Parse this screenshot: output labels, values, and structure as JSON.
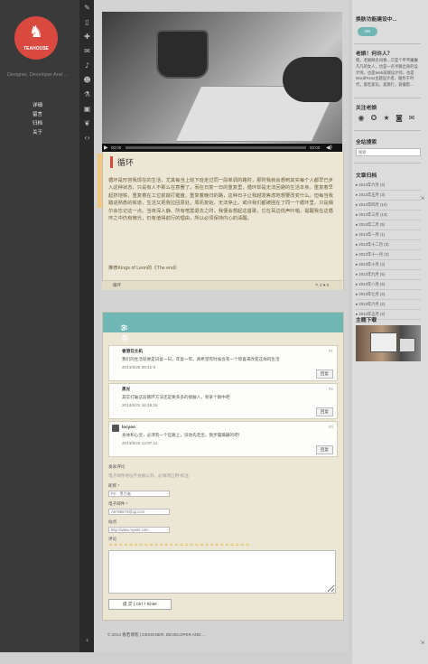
{
  "brand": {
    "logo_text": "TEAHOUSE",
    "tagline": "Designer, Developer And ..."
  },
  "nav": [
    {
      "label": "详细"
    },
    {
      "label": "留言"
    },
    {
      "label": "归档"
    },
    {
      "label": "关于"
    }
  ],
  "icons": [
    "comment-icon",
    "tablet-icon",
    "gamepad-icon",
    "envelope-icon",
    "camera-icon",
    "music-icon",
    "flask-icon",
    "film-icon",
    "image-icon",
    "code-icon"
  ],
  "player": {
    "current": "00:00",
    "total": "00:00"
  },
  "post": {
    "title": "循环",
    "body": "循环是形容我现在的生活，尤其每当上班下班走过同一段单调的路时，那时我就会想到其实每个人都早已步入这种状态，只是有人不那么在意罢了。而在日复一日的重复里，循环却是无法回避的生活本身。重复着早起挤地铁，重复着在工位前敲打键盘，重复着晚归的路，这种日子让我越发焦虑地想要改变什么。但每当我踏进熟悉的街道，生活又把我拉回原处，周而复始，无法停止。或许我们都被困在了同一个循环里，只是偶尔会忘记这一点。当夜深人静、所有喧嚣退去之时，我便会想起这首歌，它在耳边低声吟唱，提醒我在这循环之中仍有微光，仍有值得前行的理由，所以必须保持内心的清醒。",
    "signature": "推荐Kings of Leon的《The end》",
    "category": "循环",
    "comment_count": "3",
    "like_count": "0"
  },
  "comments_section": {
    "header": "3 条留言",
    "comments": [
      {
        "name": "香港云主机",
        "num": "#1",
        "text": "我们的生活就要是日复一日，年复一年。真希望有时候会有一个惊喜来改变这样的生活",
        "date": "2014/6/25 09:41:9",
        "reply": "回复"
      },
      {
        "name": "黑光",
        "num": "#2",
        "text": "其实打破这段循环方法还是要多多的接触人，到某个群中吧",
        "date": "2014/6/22 16:16:16",
        "reply": "回复"
      },
      {
        "name": "locyoo",
        "num": "#3",
        "text": "身体和心灵，必须有一个在路上，没动先走出，我步履蹒跚的吧！",
        "date": "2014/6/22 13:07:11",
        "reply": "回复"
      }
    ],
    "form": {
      "title": "发表评论",
      "note": "电子邮件地址不会被公开。必填项已用*标注",
      "name_label": "昵称 *",
      "name_placeholder": "PC - 黑引者",
      "email_label": "电子邮件 *",
      "email_placeholder": "A6786570@qq.com",
      "site_label": "站点",
      "site_placeholder": "http://www.mysite.com",
      "comment_label": "评论",
      "smileys": "☺☺☺☺☺☺☺☺☺☺☺☺☺☺☺☺☺☺☺☺☺☺☺☺☺☺☺☺",
      "submit": "提 交 ( Ctrl + Enter"
    }
  },
  "footer": {
    "text": "© 2014 春若博客 | DESIGNER, DEVELOPER AND ..."
  },
  "sidebar": {
    "switch_title": "换肤功能建设中...",
    "switch_label": "ON",
    "about_title": "老娘！何许人？",
    "about_text": "嗯，老娘网名叫春…只是个平平庸庸凡凡的女人，也是一名半路出身的设计师，也是Web前端设计师，也是WordPress主题设计者，服务于时代，爱吃爱玩，爱旅行，爱摄影...",
    "follow_title": "关注老娘",
    "social": [
      "weibo-icon",
      "tencent-icon",
      "qzone-icon",
      "rss-icon",
      "mail-icon"
    ],
    "search_title": "全站搜索",
    "search_placeholder": "搜索",
    "archive_title": "文章归档",
    "archives": [
      "2014年六月 (4)",
      "2014年五月 (3)",
      "2014年四月 (10)",
      "2014年三月 (13)",
      "2014年二月 (5)",
      "2014年一月 (1)",
      "2013年十二月 (3)",
      "2013年十一月 (2)",
      "2013年十月 (3)",
      "2013年九月 (5)",
      "2013年八月 (6)",
      "2013年七月 (4)",
      "2013年六月 (2)",
      "2013年五月 (4)"
    ],
    "theme_title": "主题下载"
  }
}
